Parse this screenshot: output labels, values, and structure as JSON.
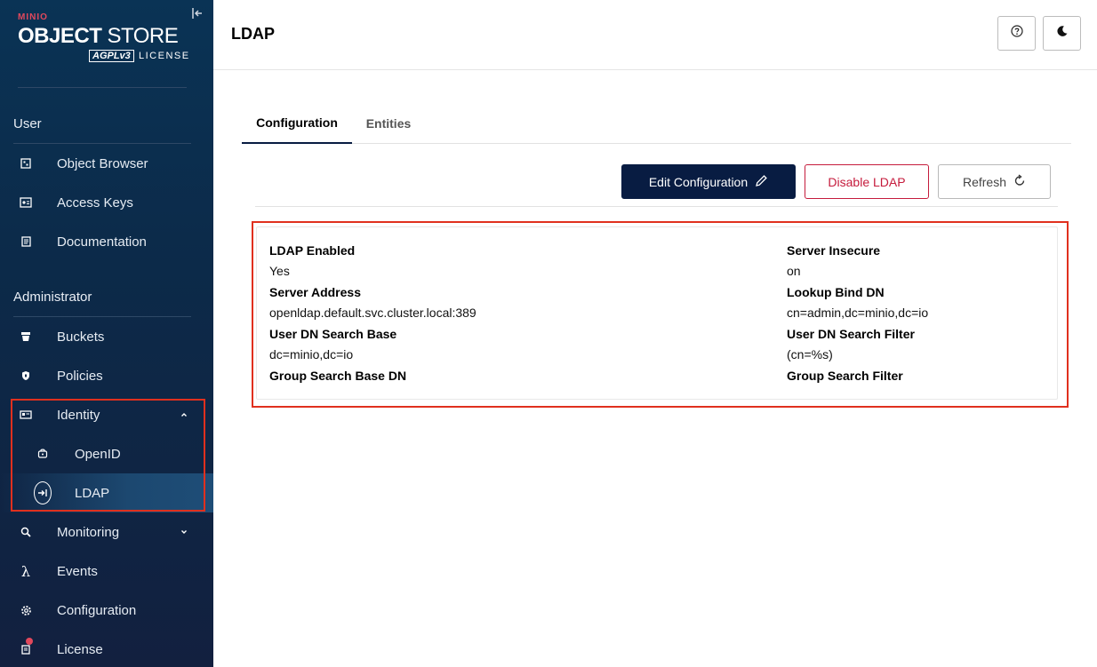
{
  "brand": {
    "vendor": "MINIO",
    "product_bold": "OBJECT",
    "product_light": "STORE",
    "license_badge": "AGPLv3",
    "license_text": "LICENSE"
  },
  "sidebar": {
    "user_section": "User",
    "user_items": [
      {
        "label": "Object Browser",
        "icon": "object-browser-icon"
      },
      {
        "label": "Access Keys",
        "icon": "access-keys-icon"
      },
      {
        "label": "Documentation",
        "icon": "documentation-icon"
      }
    ],
    "admin_section": "Administrator",
    "admin_items": [
      {
        "label": "Buckets",
        "icon": "buckets-icon"
      },
      {
        "label": "Policies",
        "icon": "policies-icon"
      },
      {
        "label": "Identity",
        "icon": "identity-icon"
      },
      {
        "label": "OpenID",
        "icon": "openid-icon"
      },
      {
        "label": "LDAP",
        "icon": "ldap-icon"
      },
      {
        "label": "Monitoring",
        "icon": "monitoring-icon"
      },
      {
        "label": "Events",
        "icon": "events-icon"
      },
      {
        "label": "Configuration",
        "icon": "configuration-icon"
      },
      {
        "label": "License",
        "icon": "license-icon"
      }
    ]
  },
  "header": {
    "title": "LDAP"
  },
  "tabs": [
    {
      "label": "Configuration",
      "active": true
    },
    {
      "label": "Entities",
      "active": false
    }
  ],
  "actions": {
    "edit": "Edit Configuration",
    "disable": "Disable LDAP",
    "refresh": "Refresh"
  },
  "details": {
    "left": [
      {
        "label": "LDAP Enabled",
        "value": "Yes"
      },
      {
        "label": "Server Address",
        "value": "openldap.default.svc.cluster.local:389"
      },
      {
        "label": "User DN Search Base",
        "value": "dc=minio,dc=io"
      },
      {
        "label": "Group Search Base DN",
        "value": ""
      }
    ],
    "right": [
      {
        "label": "Server Insecure",
        "value": "on"
      },
      {
        "label": "Lookup Bind DN",
        "value": "cn=admin,dc=minio,dc=io"
      },
      {
        "label": "User DN Search Filter",
        "value": "(cn=%s)"
      },
      {
        "label": "Group Search Filter",
        "value": ""
      }
    ]
  },
  "colors": {
    "sidebar_top": "#0a3355",
    "sidebar_bottom": "#12203f",
    "primary": "#081c42",
    "danger": "#c51b3c",
    "highlight": "#e0301e",
    "brand_red": "#e2485c"
  }
}
